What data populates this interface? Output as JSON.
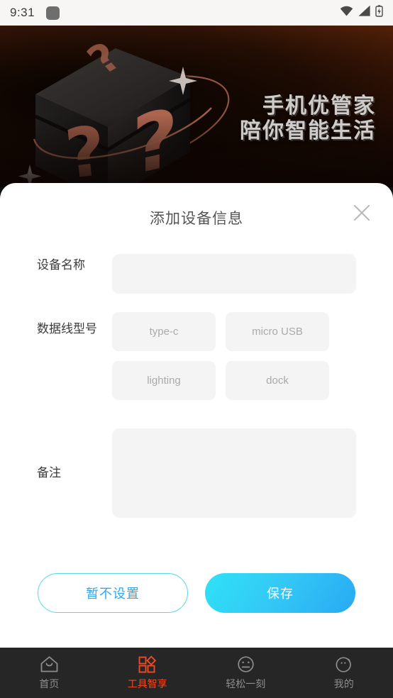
{
  "status_bar": {
    "time": "9:31",
    "app_icon": "rounded-square-icon",
    "icons": [
      "wifi-icon",
      "signal-icon",
      "battery-charging-icon"
    ]
  },
  "banner": {
    "headline_line1": "手机优管家",
    "headline_line2": "陪你智能生活",
    "art": "mystery-box-with-question-marks"
  },
  "modal": {
    "title": "添加设备信息",
    "close_icon": "close-icon",
    "fields": {
      "device_name": {
        "label": "设备名称",
        "value": "",
        "placeholder": ""
      },
      "cable_type": {
        "label": "数据线型号",
        "options": [
          "type-c",
          "micro USB",
          "lighting",
          "dock"
        ],
        "selected": ""
      },
      "remark": {
        "label": "备注",
        "value": "",
        "placeholder": ""
      }
    },
    "actions": {
      "cancel_label": "暂不设置",
      "save_label": "保存"
    }
  },
  "tabbar": {
    "items": [
      {
        "label": "首页",
        "icon": "home-icon",
        "active": false
      },
      {
        "label": "工具智享",
        "icon": "grid-tools-icon",
        "active": true
      },
      {
        "label": "轻松一刻",
        "icon": "neutral-face-icon",
        "active": false
      },
      {
        "label": "我的",
        "icon": "profile-face-icon",
        "active": false
      }
    ]
  },
  "colors": {
    "accent_primary": "#28a9f4",
    "accent_cyan": "#2fe2f6",
    "tab_active": "#f04a22",
    "field_bg": "#f4f4f5",
    "banner_bg": "#3a1606"
  }
}
